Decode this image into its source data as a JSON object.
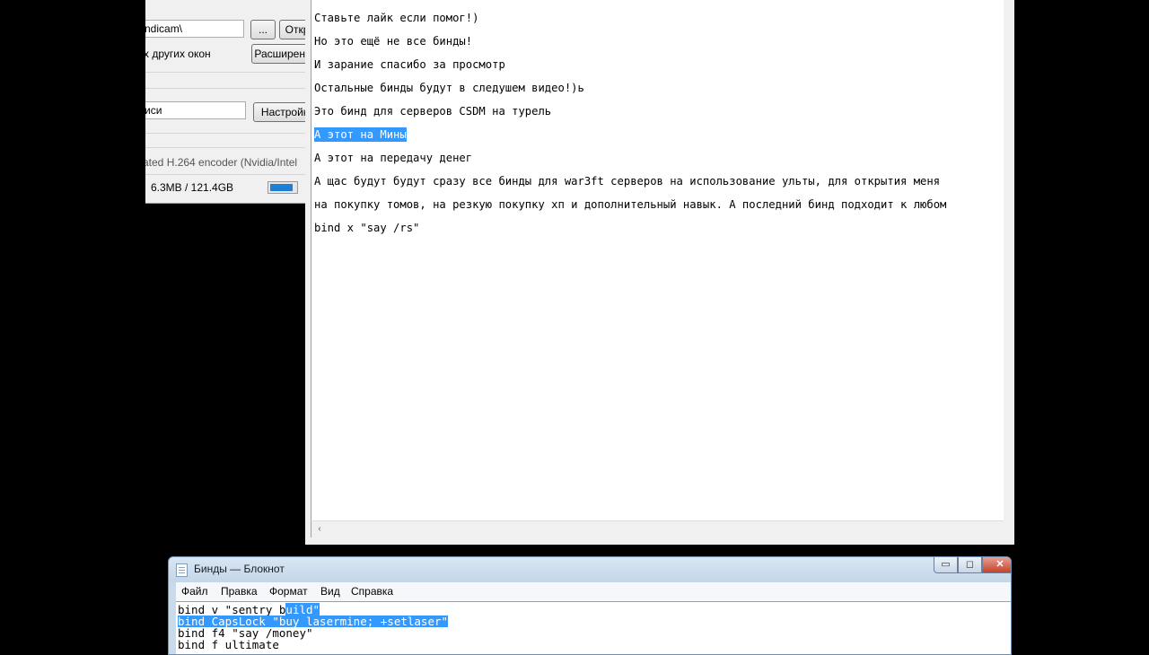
{
  "bandicam": {
    "folder_path": "ndicam\\",
    "browse_label": "...",
    "open_label": "Откр",
    "hide_other_label": "х других окон",
    "advanced_label": "Расширенн",
    "hotkey_value": "иси",
    "settings_label": "Настройк",
    "encoder_text": "ated H.264 encoder (Nvidia/Intel",
    "disk_usage": "6.3MB / 121.4GB",
    "usage_fill": 0.9
  },
  "main_notepad": {
    "lines": [
      {
        "text": "Ставьте лайк если помог!)",
        "selected": false
      },
      {
        "text": "Но это ещё не все бинды!",
        "selected": false
      },
      {
        "text": "И зарание спасибо за просмотр",
        "selected": false
      },
      {
        "text": "Остальные бинды будут в следушем видео!)ь",
        "selected": false
      },
      {
        "text": "Это бинд для серверов CSDM на турель",
        "selected": false
      },
      {
        "text": "А этот на Мины",
        "selected": true
      },
      {
        "text": "А этот на передачу денег",
        "selected": false
      },
      {
        "text": "А щас будут будут сразу все бинды для war3ft серверов на использование ульты, для открытия меня",
        "selected": false
      },
      {
        "text": "на покупку томов, на резкую покупку хп и дополнительный навык. А последний бинд подходит к любом",
        "selected": false
      },
      {
        "text": "bind x \"say /rs\"",
        "selected": false
      }
    ],
    "scroll_left_glyph": "‹"
  },
  "second_notepad": {
    "title": "Бинды — Блокнот",
    "menu": [
      "Файл",
      "Правка",
      "Формат",
      "Вид",
      "Справка"
    ],
    "code_line1_pre": "bind v \"sentry_b",
    "code_line1_sel": "uild\"",
    "code_line2": "bind CapsLock \"buy_lasermine; +setlaser\"",
    "code_line3": "bind f4 \"say /money\"",
    "code_line4": "bind f ultimate",
    "min_glyph": "▭",
    "max_glyph": "◻",
    "close_glyph": "✕"
  }
}
